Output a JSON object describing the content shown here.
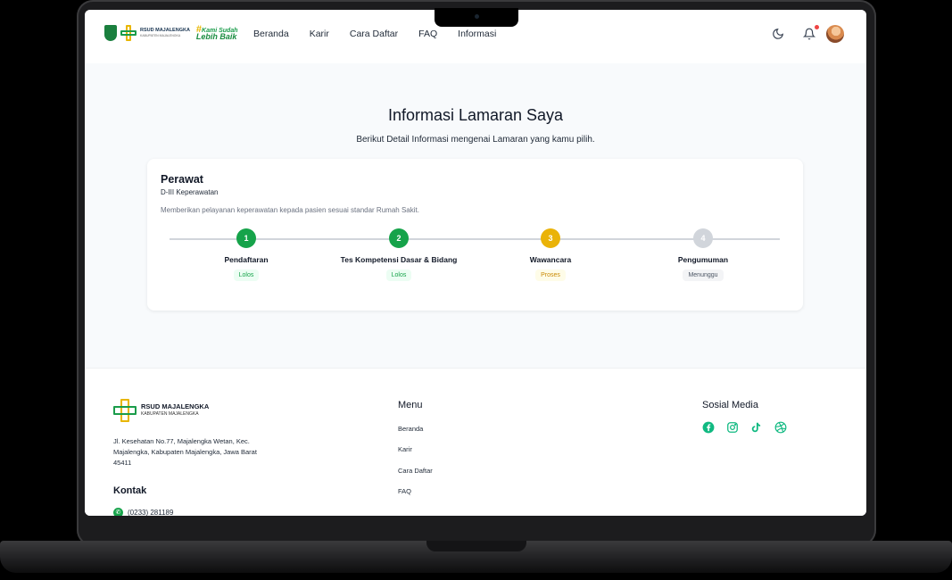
{
  "header": {
    "logo_text": "RSUD MAJALENGKA",
    "logo_subtext": "KABUPATEN MAJALENGKA",
    "slogan_small": "Kami Sudah",
    "slogan_big": "Lebih Baik",
    "nav": [
      "Beranda",
      "Karir",
      "Cara Daftar",
      "FAQ",
      "Informasi"
    ]
  },
  "page": {
    "title_main": "Informasi Lamaran",
    "title_highlight": "Saya",
    "subtitle": "Berikut Detail Informasi mengenai Lamaran yang kamu pilih."
  },
  "application": {
    "position": "Perawat",
    "level": "D-III Keperawatan",
    "description": "Memberikan pelayanan keperawatan kepada pasien sesuai standar Rumah Sakit.",
    "steps": [
      {
        "number": "1",
        "label": "Pendaftaran",
        "status": "Lolos",
        "state": "done"
      },
      {
        "number": "2",
        "label": "Tes Kompetensi Dasar & Bidang",
        "status": "Lolos",
        "state": "done"
      },
      {
        "number": "3",
        "label": "Wawancara",
        "status": "Proses",
        "state": "progress"
      },
      {
        "number": "4",
        "label": "Pengumuman",
        "status": "Menunggu",
        "state": "waiting"
      }
    ]
  },
  "footer": {
    "logo_text": "RSUD MAJALENGKA",
    "logo_subtext": "KABUPATEN MAJALENGKA",
    "address": "Jl. Kesehatan No.77, Majalengka Wetan, Kec. Majalengka, Kabupaten Majalengka, Jawa Barat 45411",
    "contact_title": "Kontak",
    "phone": "(0233) 281189",
    "menu_title": "Menu",
    "menu_items": [
      "Beranda",
      "Karir",
      "Cara Daftar",
      "FAQ"
    ],
    "social_title": "Sosial Media",
    "social_icons": [
      "facebook-icon",
      "instagram-icon",
      "tiktok-icon",
      "dribbble-icon"
    ]
  },
  "colors": {
    "done": "#16a34a",
    "progress": "#eab308",
    "waiting": "#d1d5db",
    "social": "#10b981"
  }
}
